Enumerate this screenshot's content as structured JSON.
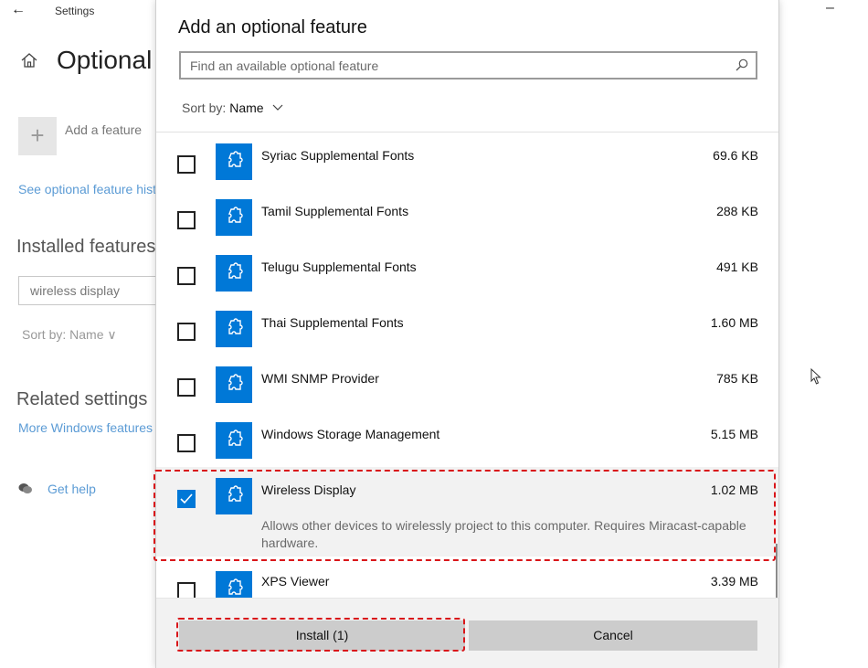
{
  "window": {
    "title": "Settings",
    "page_title": "Optional features",
    "add_feature_label": "Add a feature",
    "history_link": "See optional feature history",
    "installed_heading": "Installed features",
    "installed_search_value": "wireless display",
    "installed_sort": "Sort by: Name",
    "related_heading": "Related settings",
    "more_features_link": "More Windows features",
    "get_help_link": "Get help"
  },
  "dialog": {
    "title": "Add an optional feature",
    "search_placeholder": "Find an available optional feature",
    "sort_label": "Sort by:",
    "sort_value": "Name",
    "features": [
      {
        "name": "Syriac Supplemental Fonts",
        "size": "69.6 KB",
        "checked": false
      },
      {
        "name": "Tamil Supplemental Fonts",
        "size": "288 KB",
        "checked": false
      },
      {
        "name": "Telugu Supplemental Fonts",
        "size": "491 KB",
        "checked": false
      },
      {
        "name": "Thai Supplemental Fonts",
        "size": "1.60 MB",
        "checked": false
      },
      {
        "name": "WMI SNMP Provider",
        "size": "785 KB",
        "checked": false
      },
      {
        "name": "Windows Storage Management",
        "size": "5.15 MB",
        "checked": false
      },
      {
        "name": "Wireless Display",
        "size": "1.02 MB",
        "checked": true,
        "description": "Allows other devices to wirelessly project to this computer.  Requires Miracast-capable hardware."
      },
      {
        "name": "XPS Viewer",
        "size": "3.39 MB",
        "checked": false
      }
    ],
    "install_label": "Install (1)",
    "cancel_label": "Cancel"
  },
  "colors": {
    "accent": "#0078d7",
    "link": "#5b9bd5",
    "annotation": "#d9161a"
  },
  "icons": [
    "back-arrow-icon",
    "home-icon",
    "plus-icon",
    "search-icon",
    "chevron-down-icon",
    "puzzle-piece-icon",
    "checkmark-icon",
    "help-chat-icon",
    "mouse-cursor-icon",
    "minimize-icon"
  ]
}
